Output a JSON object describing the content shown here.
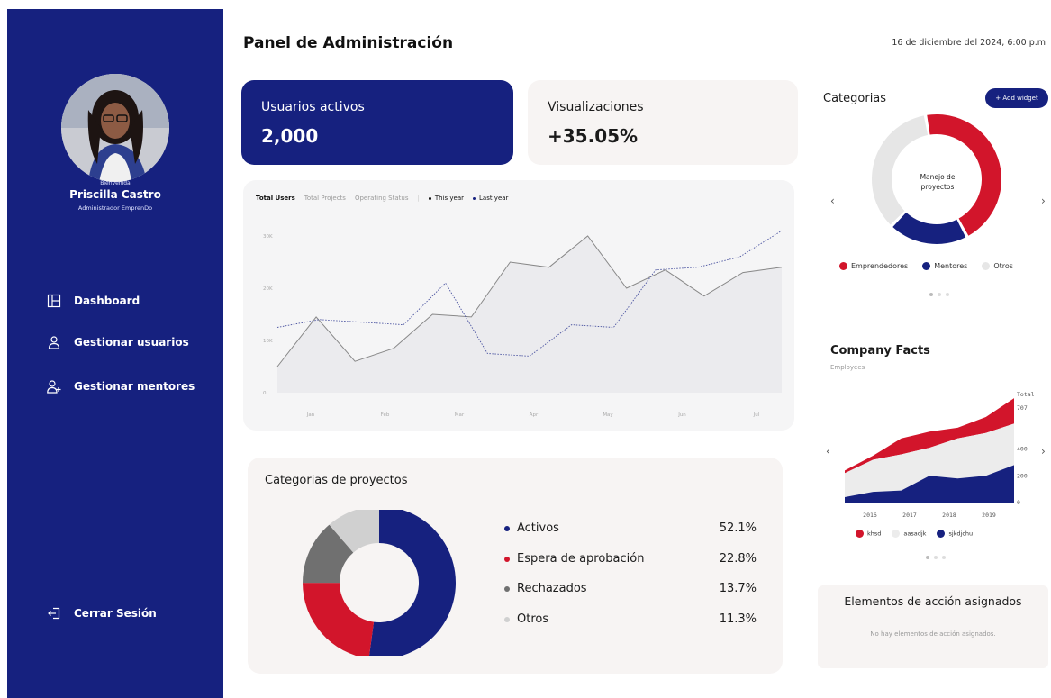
{
  "header": {
    "title": "Panel de Administración",
    "date": "16 de diciembre del 2024, 6:00 p.m"
  },
  "sidebar": {
    "greeting": "Bienvenida",
    "user_name": "Priscilla Castro",
    "user_role": "Administrador EmprenDo",
    "items": [
      {
        "label": "Dashboard",
        "icon": "layout-icon"
      },
      {
        "label": "Gestionar usuarios",
        "icon": "user-icon"
      },
      {
        "label": "Gestionar mentores",
        "icon": "user-plus-icon"
      }
    ],
    "logout_label": "Cerrar Sesión",
    "bg_color": "#16217f"
  },
  "kpis": {
    "active_users_label": "Usuarios activos",
    "active_users_value": "2,000",
    "views_label": "Visualizaciones",
    "views_value": "+35.05%"
  },
  "line_chart": {
    "tabs": [
      "Total Users",
      "Total Projects",
      "Operating Status"
    ],
    "active_tab": "Total Users",
    "legend": [
      "This year",
      "Last year"
    ]
  },
  "categorias": {
    "title": "Categorias",
    "add_widget_label": "+ Add widget",
    "center_label": "Manejo de proyectos",
    "legend": [
      {
        "label": "Emprendedores",
        "color": "#d2152b"
      },
      {
        "label": "Mentores",
        "color": "#16217f"
      },
      {
        "label": "Otros",
        "color": "#e6e6e6"
      }
    ]
  },
  "company_facts": {
    "title": "Company Facts",
    "subtitle": "Employees",
    "legend": [
      {
        "label": "khsd",
        "color": "#d2152b"
      },
      {
        "label": "aasadjk",
        "color": "#ececec"
      },
      {
        "label": "sjkdjchu",
        "color": "#16217f"
      }
    ]
  },
  "project_categories": {
    "title": "Categorias de proyectos",
    "rows": [
      {
        "label": "Activos",
        "value": "52.1%",
        "color": "#16217f"
      },
      {
        "label": "Espera de aprobación",
        "value": "22.8%",
        "color": "#d2152b"
      },
      {
        "label": "Rechazados",
        "value": "13.7%",
        "color": "#707070"
      },
      {
        "label": "Otros",
        "value": "11.3%",
        "color": "#d0d0d0"
      }
    ]
  },
  "action_items": {
    "title": "Elementos de acción asignados",
    "empty_text": "No hay elementos de acción asignados."
  },
  "chart_data": [
    {
      "type": "line",
      "x": [
        "Jan",
        "Feb",
        "Mar",
        "Apr",
        "May",
        "Jun",
        "Jul"
      ],
      "yticks": [
        "0",
        "10K",
        "20K",
        "30K"
      ],
      "ylim": [
        0,
        30000
      ],
      "series": [
        {
          "name": "This year",
          "values": [
            5000,
            14500,
            6000,
            8500,
            15000,
            14500,
            25000,
            24000,
            30000,
            20000,
            23500,
            18500,
            23000,
            24000
          ]
        },
        {
          "name": "Last year",
          "values": [
            12500,
            14000,
            13500,
            13000,
            21000,
            7500,
            7000,
            13000,
            12500,
            23500,
            24000,
            26000,
            31000
          ]
        }
      ]
    },
    {
      "type": "pie",
      "title": "Categorias",
      "labels": [
        "Emprendedores",
        "Mentores",
        "Otros"
      ],
      "values": [
        45,
        20,
        35
      ]
    },
    {
      "type": "area",
      "title": "Company Facts",
      "x": [
        "2016",
        "2017",
        "2018",
        "2019"
      ],
      "yticks": [
        "0",
        "200",
        "400",
        "707"
      ],
      "ylim": [
        0,
        707
      ],
      "series": [
        {
          "name": "sjkdjchu",
          "values": [
            40,
            80,
            90,
            200,
            180,
            200,
            280
          ]
        },
        {
          "name": "aasadjk",
          "values": [
            180,
            240,
            270,
            210,
            300,
            320,
            310
          ]
        },
        {
          "name": "khsd",
          "values": [
            20,
            30,
            120,
            120,
            80,
            120,
            190
          ]
        }
      ]
    },
    {
      "type": "pie",
      "title": "Categorias de proyectos",
      "labels": [
        "Activos",
        "Espera de aprobación",
        "Rechazados",
        "Otros"
      ],
      "values": [
        52.1,
        22.8,
        13.7,
        11.3
      ]
    }
  ]
}
